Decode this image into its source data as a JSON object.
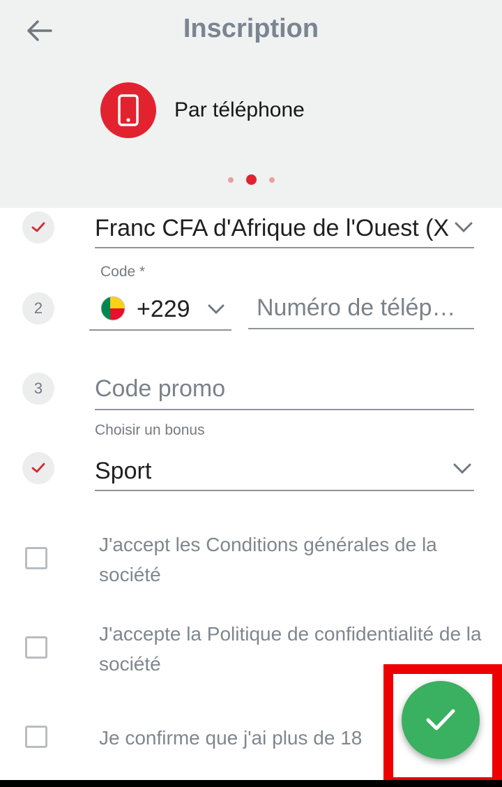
{
  "header": {
    "title": "Inscription",
    "method_label": "Par téléphone",
    "pager": {
      "count": 3,
      "active": 2
    }
  },
  "form": {
    "currency": {
      "value": "Franc CFA d'Afrique de l'Ouest (X"
    },
    "phone": {
      "step": "2",
      "code_label": "Code *",
      "code_value": "+229",
      "number_placeholder": "Numéro de télép…"
    },
    "promo": {
      "step": "3",
      "placeholder": "Code promo"
    },
    "bonus": {
      "label": "Choisir un bonus",
      "value": "Sport"
    }
  },
  "agreements": [
    {
      "text": "J'accept les Conditions générales de la société"
    },
    {
      "text": "J'accepte la Politique de confidentialité de la société"
    },
    {
      "text": "Je confirme que j'ai plus de 18"
    }
  ],
  "colors": {
    "accent": "#e2232f",
    "success": "#3ab061",
    "header_bg": "#f0f2f1"
  }
}
